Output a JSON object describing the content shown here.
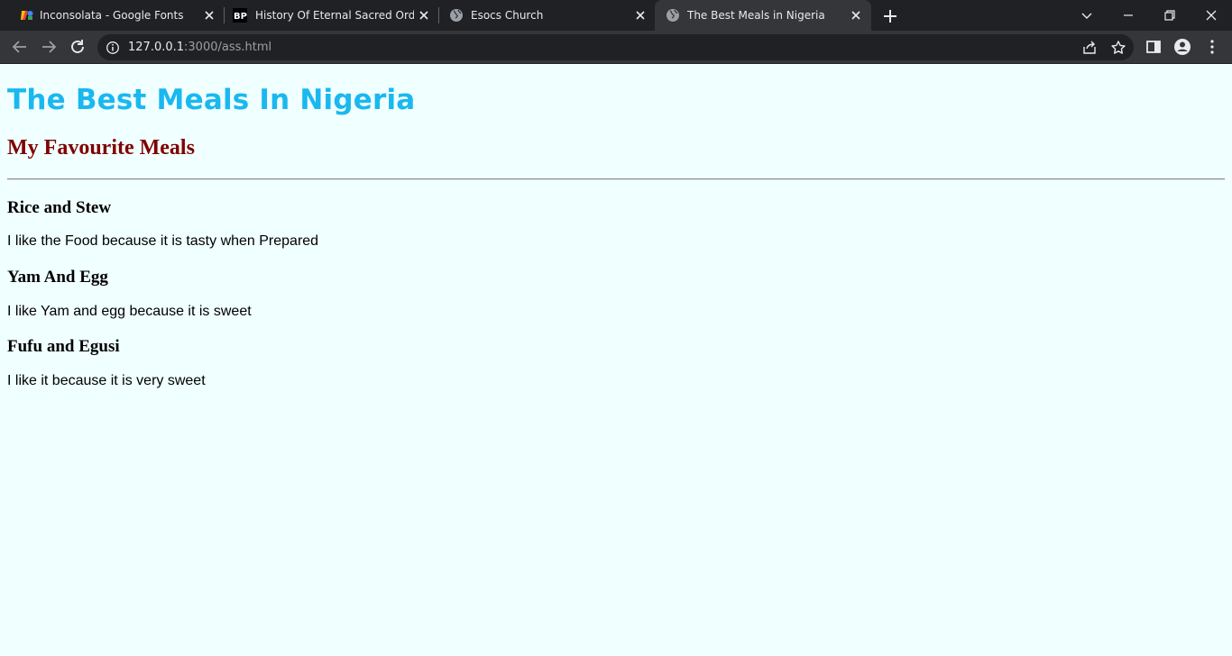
{
  "browser": {
    "tabs": [
      {
        "title": "Inconsolata - Google Fonts",
        "icon": "google-fonts-icon",
        "active": false
      },
      {
        "title": "History Of Eternal Sacred Order C",
        "icon": "bp-site-icon",
        "active": false
      },
      {
        "title": "Esocs Church",
        "icon": "globe-icon",
        "active": false
      },
      {
        "title": "The Best Meals in Nigeria",
        "icon": "globe-icon",
        "active": true
      }
    ],
    "url_host": "127.0.0.1",
    "url_rest": ":3000/ass.html"
  },
  "page": {
    "title": "The Best Meals In Nigeria",
    "subtitle": "My Favourite Meals",
    "meals": [
      {
        "name": "Rice and Stew",
        "description": "I like the Food because it is tasty when Prepared"
      },
      {
        "name": "Yam And Egg",
        "description": "I like Yam and egg because it is sweet"
      },
      {
        "name": "Fufu and Egusi",
        "description": "I like it because it is very sweet"
      }
    ]
  },
  "colors": {
    "title": "#1ab8ef",
    "subtitle": "#800000",
    "background": "#f0ffff"
  }
}
